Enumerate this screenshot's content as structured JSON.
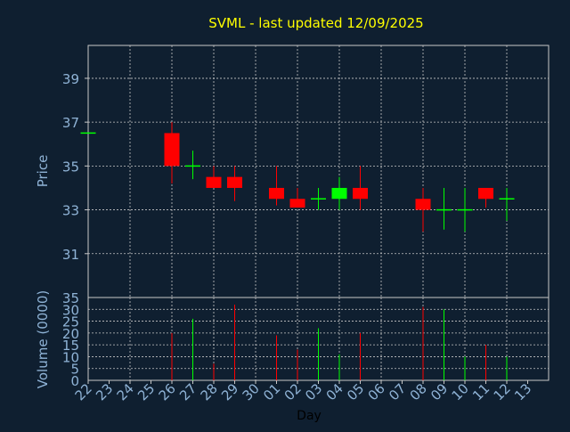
{
  "colors": {
    "background": "#0f1f30",
    "title": "#ffff00",
    "axis_text": "#8fb3d6",
    "grid": "#c8c8c8",
    "frame": "#c8c8c8",
    "up": "#00ff00",
    "down": "#ff0000",
    "day_label": "#000000"
  },
  "chart_data": {
    "type": "candlestick",
    "title": "SVML - last updated 12/09/2025",
    "xlabel": "Day",
    "x_tick_labels": [
      "22",
      "23",
      "24",
      "25",
      "26",
      "27",
      "28",
      "29",
      "30",
      "01",
      "02",
      "03",
      "04",
      "05",
      "06",
      "07",
      "08",
      "09",
      "10",
      "11",
      "12",
      "13"
    ],
    "price_panel": {
      "ylabel": "Price",
      "ylim": [
        29,
        40.5
      ],
      "yticks": [
        31,
        33,
        35,
        37,
        39
      ],
      "grid": true,
      "candles": [
        {
          "x": "22",
          "open": 36.5,
          "high": 36.5,
          "low": 36.5,
          "close": 36.5
        },
        {
          "x": "26",
          "open": 36.5,
          "high": 37.0,
          "low": 34.2,
          "close": 35.0
        },
        {
          "x": "27",
          "open": 35.0,
          "high": 35.7,
          "low": 34.4,
          "close": 35.0
        },
        {
          "x": "28",
          "open": 34.5,
          "high": 35.0,
          "low": 34.0,
          "close": 34.0
        },
        {
          "x": "29",
          "open": 34.5,
          "high": 35.0,
          "low": 33.4,
          "close": 34.0
        },
        {
          "x": "01",
          "open": 34.0,
          "high": 35.0,
          "low": 33.2,
          "close": 33.5
        },
        {
          "x": "02",
          "open": 33.5,
          "high": 34.0,
          "low": 33.1,
          "close": 33.1
        },
        {
          "x": "03",
          "open": 33.5,
          "high": 34.0,
          "low": 33.0,
          "close": 33.5
        },
        {
          "x": "04",
          "open": 33.5,
          "high": 34.5,
          "low": 33.0,
          "close": 34.0
        },
        {
          "x": "05",
          "open": 34.0,
          "high": 35.0,
          "low": 33.0,
          "close": 33.5
        },
        {
          "x": "08",
          "open": 33.5,
          "high": 34.0,
          "low": 32.0,
          "close": 33.0
        },
        {
          "x": "09",
          "open": 33.0,
          "high": 34.0,
          "low": 32.1,
          "close": 33.0
        },
        {
          "x": "10",
          "open": 33.0,
          "high": 34.0,
          "low": 32.0,
          "close": 33.0
        },
        {
          "x": "11",
          "open": 34.0,
          "high": 34.0,
          "low": 33.1,
          "close": 33.5
        },
        {
          "x": "12",
          "open": 33.5,
          "high": 34.0,
          "low": 32.5,
          "close": 33.5
        }
      ]
    },
    "volume_panel": {
      "ylabel": "Volume (0000)",
      "ylim": [
        0,
        35
      ],
      "yticks": [
        0,
        5,
        10,
        15,
        20,
        25,
        30,
        35
      ],
      "grid": true,
      "bars": [
        {
          "x": "26",
          "value": 20,
          "direction": "down"
        },
        {
          "x": "27",
          "value": 26,
          "direction": "up"
        },
        {
          "x": "28",
          "value": 7,
          "direction": "down"
        },
        {
          "x": "29",
          "value": 32,
          "direction": "down"
        },
        {
          "x": "01",
          "value": 19,
          "direction": "down"
        },
        {
          "x": "02",
          "value": 13,
          "direction": "down"
        },
        {
          "x": "03",
          "value": 22,
          "direction": "up"
        },
        {
          "x": "04",
          "value": 11,
          "direction": "up"
        },
        {
          "x": "05",
          "value": 20,
          "direction": "down"
        },
        {
          "x": "08",
          "value": 31,
          "direction": "down"
        },
        {
          "x": "09",
          "value": 30,
          "direction": "up"
        },
        {
          "x": "10",
          "value": 10,
          "direction": "up"
        },
        {
          "x": "11",
          "value": 15,
          "direction": "down"
        },
        {
          "x": "12",
          "value": 10,
          "direction": "up"
        }
      ]
    }
  }
}
